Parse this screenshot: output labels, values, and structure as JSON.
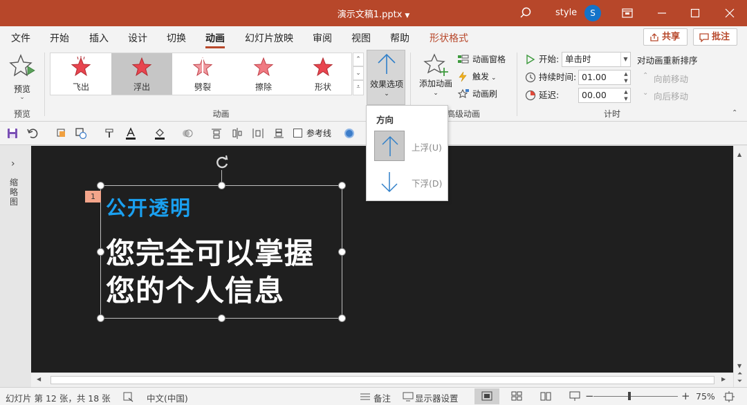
{
  "titlebar": {
    "title": "演示文稿1.pptx",
    "user": "style",
    "avatar_letter": "S",
    "bg_color": "#b7472a"
  },
  "tabs": {
    "items": [
      "文件",
      "开始",
      "插入",
      "设计",
      "切换",
      "动画",
      "幻灯片放映",
      "审阅",
      "视图",
      "帮助",
      "形状格式"
    ],
    "active": "动画",
    "share": "共享",
    "comment": "批注"
  },
  "ribbon": {
    "preview": {
      "label": "预览",
      "group": "预览"
    },
    "animation_group": "动画",
    "gallery": [
      {
        "label": "飞出",
        "selected": false
      },
      {
        "label": "浮出",
        "selected": true
      },
      {
        "label": "劈裂",
        "selected": false
      },
      {
        "label": "擦除",
        "selected": false
      },
      {
        "label": "形状",
        "selected": false
      }
    ],
    "effect_options": "效果选项",
    "add_animation": "添加动画",
    "animation_pane": "动画窗格",
    "trigger": "触发",
    "anim_painter": "动画刷",
    "advanced_group": "高级动画",
    "timing": {
      "start_label": "开始:",
      "start_value": "单击时",
      "duration_label": "持续时间:",
      "duration_value": "01.00",
      "delay_label": "延迟:",
      "delay_value": "00.00",
      "group": "计时"
    },
    "reorder": {
      "title": "对动画重新排序",
      "forward": "向前移动",
      "backward": "向后移动"
    }
  },
  "qat": {
    "guides_label": "参考线"
  },
  "thumbpane": {
    "label": "缩略图"
  },
  "slide": {
    "anim_number": "1",
    "subtitle": "公开透明",
    "title_line1": "您完全可以掌握",
    "title_line2": "您的个人信息",
    "subtitle_color": "#1aa0f0"
  },
  "dropdown": {
    "header": "方向",
    "options": [
      {
        "label": "上浮(U)",
        "selected": true
      },
      {
        "label": "下浮(D)",
        "selected": false
      }
    ]
  },
  "statusbar": {
    "slide_info": "幻灯片 第 12 张，共 18 张",
    "language": "中文(中国)",
    "notes": "备注",
    "display_settings": "显示器设置",
    "zoom": "75%"
  }
}
